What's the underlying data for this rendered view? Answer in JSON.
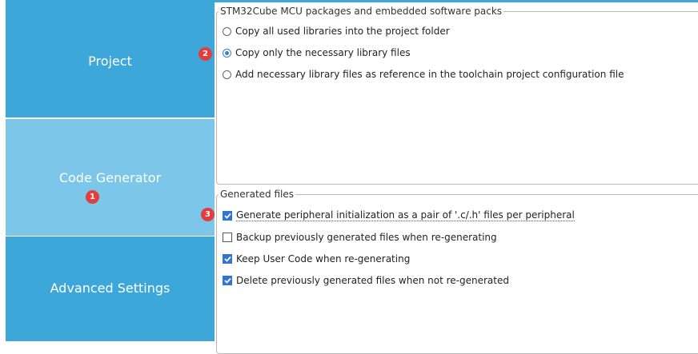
{
  "sidebar": {
    "items": [
      {
        "label": "Project"
      },
      {
        "label": "Code Generator"
      },
      {
        "label": "Advanced Settings"
      }
    ]
  },
  "packages": {
    "legend": "STM32Cube MCU packages and embedded software packs",
    "options": [
      {
        "label": "Copy all used libraries into the project folder",
        "selected": false
      },
      {
        "label": "Copy only the necessary library files",
        "selected": true
      },
      {
        "label": "Add necessary library files as reference in the toolchain project configuration file",
        "selected": false
      }
    ]
  },
  "generated": {
    "legend": "Generated files",
    "options": [
      {
        "label": "Generate peripheral initialization as a pair of '.c/.h' files per peripheral",
        "checked": true
      },
      {
        "label": "Backup previously generated files when re-generating",
        "checked": false
      },
      {
        "label": "Keep User Code when re-generating",
        "checked": true
      },
      {
        "label": "Delete previously generated files when not re-generated",
        "checked": true
      }
    ]
  },
  "badges": [
    "1",
    "2",
    "3"
  ],
  "colors": {
    "sidebar_active": "#3ea7da",
    "sidebar_selected": "#7cc6e9",
    "badge": "#e33d3d",
    "check": "#2f76d2"
  }
}
